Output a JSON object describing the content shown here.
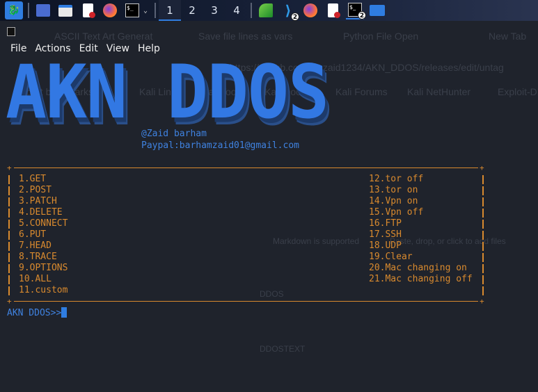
{
  "taskbar": {
    "workspaces": [
      "1",
      "2",
      "3",
      "4"
    ],
    "active_workspace": "1",
    "badges": {
      "vscode": "2",
      "terminal": "2"
    }
  },
  "background_ghost": {
    "tabs": [
      "ASCII Text Art Generat",
      "Save file lines as vars",
      "Python File Open",
      "New Tab"
    ],
    "url": "https://github.com/thezaid1234/AKN_DDOS/releases/edit/untag",
    "bookmarks": [
      "Import bookmarks...",
      "Kali Linux",
      "Kali Tools",
      "Kali Docs",
      "Kali Forums",
      "Kali NetHunter",
      "Exploit-DB"
    ],
    "editor_hints": [
      "Markdown is supported",
      "Paste, drop, or click to add files"
    ],
    "fields": [
      "DDOS",
      "DDOSTEXT"
    ]
  },
  "menu": [
    "File",
    "Actions",
    "Edit",
    "View",
    "Help"
  ],
  "banner": {
    "title": "AKN DDOS",
    "author": "@Zaid barham",
    "paypal": "Paypal:barhamzaid01@gmail.com"
  },
  "options_left": [
    "1.GET",
    "2.POST",
    "3.PATCH",
    "4.DELETE",
    "5.CONNECT",
    "6.PUT",
    "7.HEAD",
    "8.TRACE",
    "9.OPTIONS",
    "10.ALL",
    "11.custom"
  ],
  "options_right": [
    "12.tor off",
    "13.tor on",
    "14.Vpn on",
    "15.Vpn off",
    "16.FTP",
    "17.SSH",
    "18.UDP",
    "19.Clear",
    "20.Mac changing on",
    "21.Mac changing off"
  ],
  "prompt": "AKN DDOS>>",
  "colors": {
    "accent": "#3278e3",
    "menu_text": "#d98a2e",
    "bg": "#1f232c"
  }
}
